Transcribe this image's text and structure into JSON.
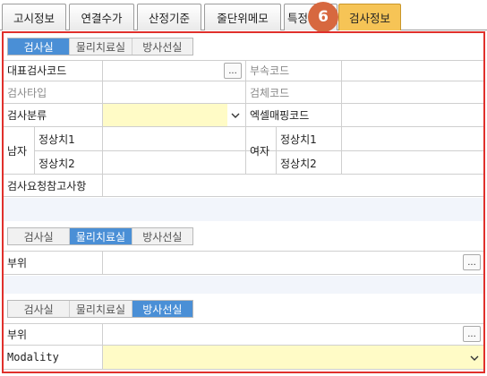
{
  "tabs": [
    "고시정보",
    "연결수가",
    "산정기준",
    "줄단위메모",
    "특정",
    "검사정보"
  ],
  "callout_number": "6",
  "section1": {
    "toggle": [
      "검사실",
      "물리치료실",
      "방사선실"
    ],
    "rep_code_label": "대표검사코드",
    "dept_code_label": "부속코드",
    "test_type_label": "검사타입",
    "specimen_code_label": "검체코드",
    "test_class_label": "검사분류",
    "excel_map_label": "엑셀매핑코드",
    "male_label": "남자",
    "female_label": "여자",
    "normal1_label": "정상치1",
    "normal2_label": "정상치2",
    "request_note_label": "검사요청참고사항",
    "browse": "..."
  },
  "section2": {
    "toggle": [
      "검사실",
      "물리치료실",
      "방사선실"
    ],
    "site_label": "부위",
    "browse": "..."
  },
  "section3": {
    "toggle": [
      "검사실",
      "물리치료실",
      "방사선실"
    ],
    "site_label": "부위",
    "modality_label": "Modality",
    "browse": "..."
  },
  "colors": {
    "accent": "#4a8fd6",
    "active_tab": "#f6c456",
    "badge": "#d7683f",
    "frame": "#e0302c",
    "required": "#fffbc6"
  }
}
